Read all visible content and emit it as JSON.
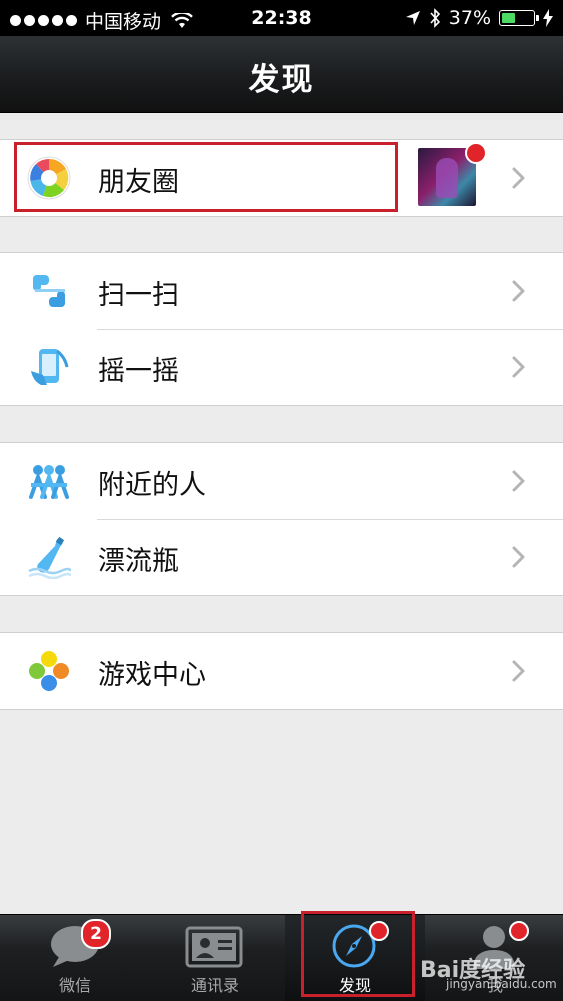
{
  "status_bar": {
    "carrier": "中国移动",
    "time": "22:38",
    "battery_percent": "37%"
  },
  "nav": {
    "title": "发现"
  },
  "groups": [
    {
      "items": [
        {
          "label": "朋友圈",
          "icon": "moments-camera-icon",
          "has_thumbnail": true,
          "has_red_dot": true
        }
      ]
    },
    {
      "items": [
        {
          "label": "扫一扫",
          "icon": "scan-icon"
        },
        {
          "label": "摇一摇",
          "icon": "shake-phone-icon"
        }
      ]
    },
    {
      "items": [
        {
          "label": "附近的人",
          "icon": "people-nearby-icon"
        },
        {
          "label": "漂流瓶",
          "icon": "drift-bottle-icon"
        }
      ]
    },
    {
      "items": [
        {
          "label": "游戏中心",
          "icon": "game-center-icon"
        }
      ]
    }
  ],
  "tab_bar": {
    "tabs": [
      {
        "label": "微信",
        "icon": "chat-bubble-icon",
        "badge": "2"
      },
      {
        "label": "通讯录",
        "icon": "contacts-card-icon"
      },
      {
        "label": "发现",
        "icon": "compass-icon",
        "active": true,
        "red_dot": true
      },
      {
        "label": "我",
        "icon": "person-icon",
        "red_dot": true
      }
    ]
  },
  "watermark": {
    "line1": "Bai度经验",
    "line2": "jingyan.baidu.com"
  },
  "colors": {
    "highlight": "#c9212c",
    "badge": "#e0242a"
  }
}
